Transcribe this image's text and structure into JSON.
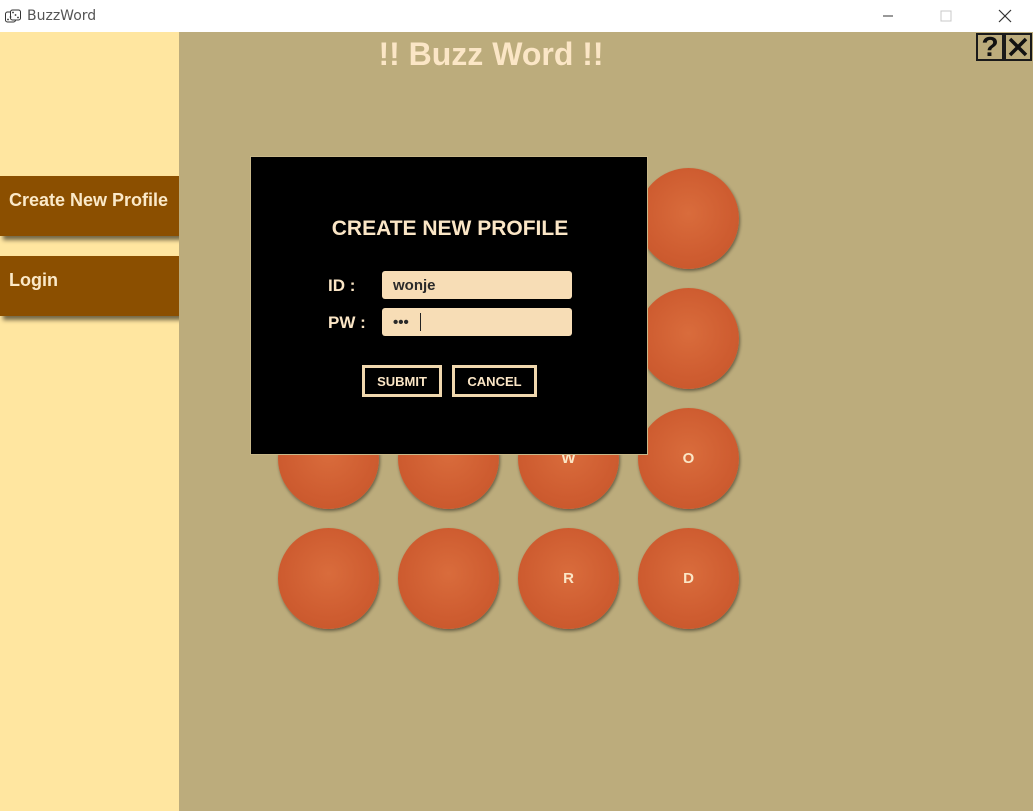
{
  "window": {
    "title": "BuzzWord",
    "icon": "dice-icon",
    "controls": [
      "minimize-icon",
      "maximize-icon",
      "close-icon"
    ]
  },
  "sidebar": {
    "items": [
      {
        "label": "Create New Profile"
      },
      {
        "label": "Login"
      }
    ]
  },
  "main": {
    "title": "!! Buzz Word !!",
    "help_label": "?",
    "close_label": "✕",
    "grid": [
      [
        "",
        "",
        "",
        ""
      ],
      [
        "",
        "",
        "",
        ""
      ],
      [
        "",
        "",
        "W",
        "O"
      ],
      [
        "",
        "",
        "R",
        "D"
      ]
    ]
  },
  "modal": {
    "title": "CREATE NEW PROFILE",
    "id_label": "ID :",
    "pw_label": "PW :",
    "id_value": "wonje",
    "pw_value": "abc",
    "submit_label": "SUBMIT",
    "cancel_label": "CANCEL"
  },
  "colors": {
    "sidebar_bg": "#ffe6a0",
    "nav_button": "#8b4f00",
    "main_bg": "#bcac7c",
    "circle": "#d0602f",
    "modal_bg": "#000000",
    "input_bg": "#f7ddb6",
    "accent_text": "#fbe6c6"
  }
}
